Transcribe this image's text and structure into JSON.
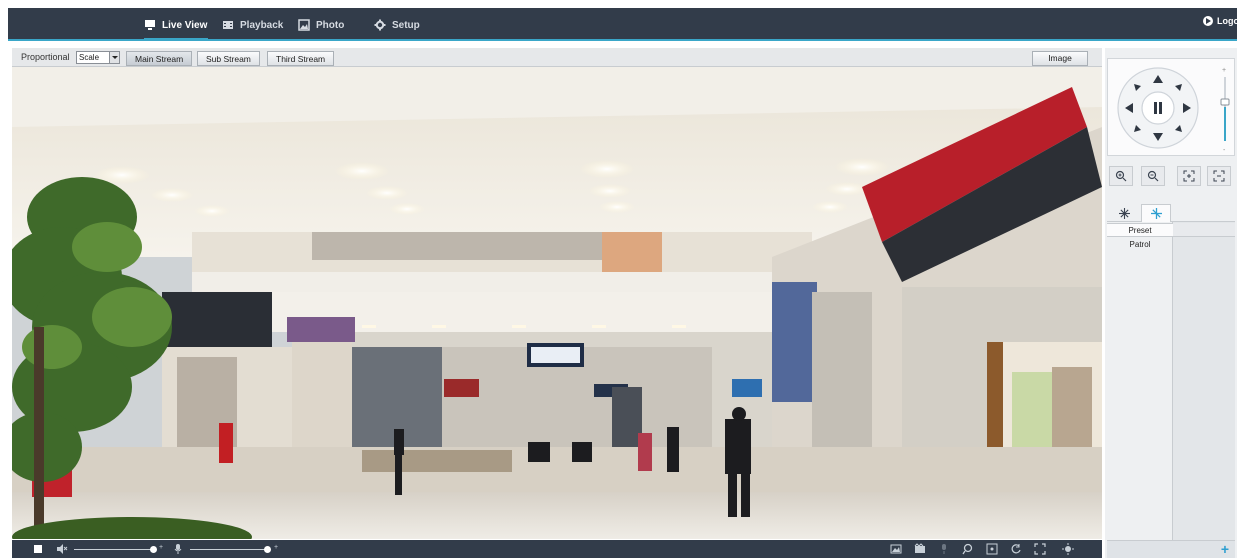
{
  "nav": {
    "items": [
      {
        "label": "Live View",
        "icon": "monitor-icon"
      },
      {
        "label": "Playback",
        "icon": "film-icon"
      },
      {
        "label": "Photo",
        "icon": "photo-icon"
      },
      {
        "label": "Setup",
        "icon": "gear-icon"
      }
    ],
    "active": "Live View",
    "logout_label": "Logout"
  },
  "toolbar": {
    "ratio_label": "Proportional",
    "ratio_value": "Scale",
    "streams": [
      "Main Stream",
      "Sub Stream",
      "Third Stream"
    ],
    "active_stream": "Main Stream",
    "image_button": "Image"
  },
  "ptz": {
    "speed_plus": "+",
    "speed_minus": "-"
  },
  "panel": {
    "tabs": [
      "snowflake-icon",
      "pattern-icon"
    ],
    "list_items": [
      "Preset",
      "Patrol"
    ],
    "selected_item": "Preset",
    "add_button": "+"
  },
  "bottombar": {
    "volume_level": 0.9,
    "mic_level": 0.9,
    "slider_plus": "+"
  },
  "colors": {
    "nav_bg": "#323c4a",
    "accent": "#3aa6c8",
    "add_icon": "#2e9fd0"
  }
}
